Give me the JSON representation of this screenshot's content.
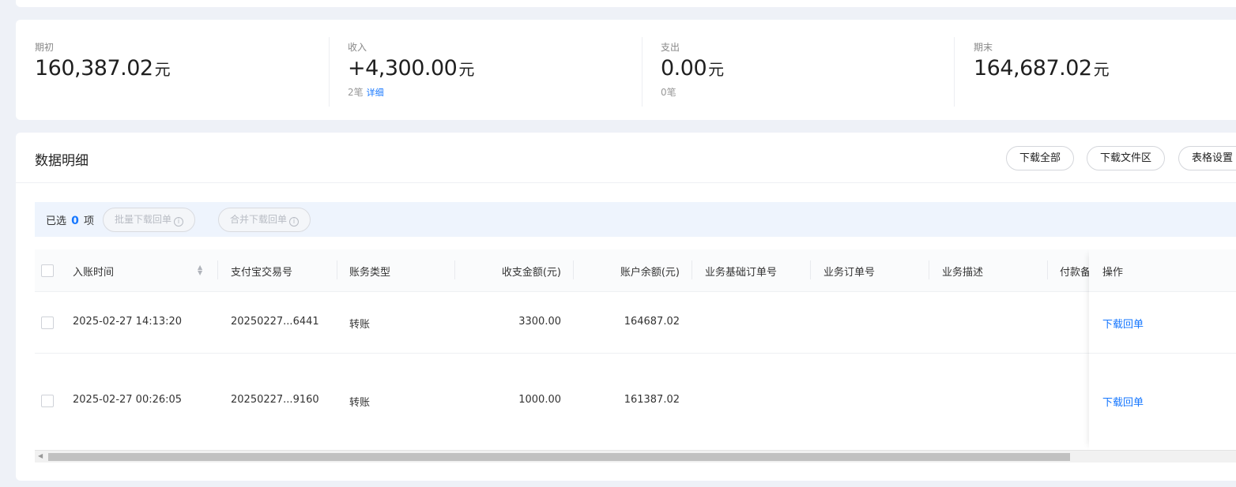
{
  "summary": {
    "opening": {
      "label": "期初",
      "value": "160,387.02",
      "unit": "元"
    },
    "income": {
      "label": "收入",
      "value": "+4,300.00",
      "unit": "元",
      "count": "2笔",
      "detail_link": "详细"
    },
    "expense": {
      "label": "支出",
      "value": "0.00",
      "unit": "元",
      "count": "0笔"
    },
    "closing": {
      "label": "期末",
      "value": "164,687.02",
      "unit": "元"
    }
  },
  "detail": {
    "title": "数据明细",
    "buttons": {
      "download_all": "下载全部",
      "download_area": "下载文件区",
      "table_settings": "表格设置"
    }
  },
  "selection": {
    "prefix": "已选",
    "count": "0",
    "suffix": "项",
    "batch_download": "批量下载回单",
    "merge_download": "合并下载回单",
    "info_glyph": "i"
  },
  "table": {
    "columns": [
      "入账时间",
      "支付宝交易号",
      "账务类型",
      "收支金额(元)",
      "账户余额(元)",
      "业务基础订单号",
      "业务订单号",
      "业务描述",
      "付款备",
      "操作"
    ],
    "rows": [
      {
        "time": "2025-02-27 14:13:20",
        "trade_no": "20250227...6441",
        "type": "转账",
        "amount": "3300.00",
        "balance": "164687.02",
        "action": "下载回单"
      },
      {
        "time": "2025-02-27 00:26:05",
        "trade_no": "20250227...9160",
        "type": "转账",
        "amount": "1000.00",
        "balance": "161387.02",
        "action": "下载回单"
      }
    ]
  },
  "icons": {
    "sort": "sort-icon",
    "info": "info-icon",
    "scroll_left": "chevron-left-icon"
  },
  "colors": {
    "accent": "#1677ff",
    "background": "#eef1f7",
    "select_bar": "#eef4fd"
  }
}
